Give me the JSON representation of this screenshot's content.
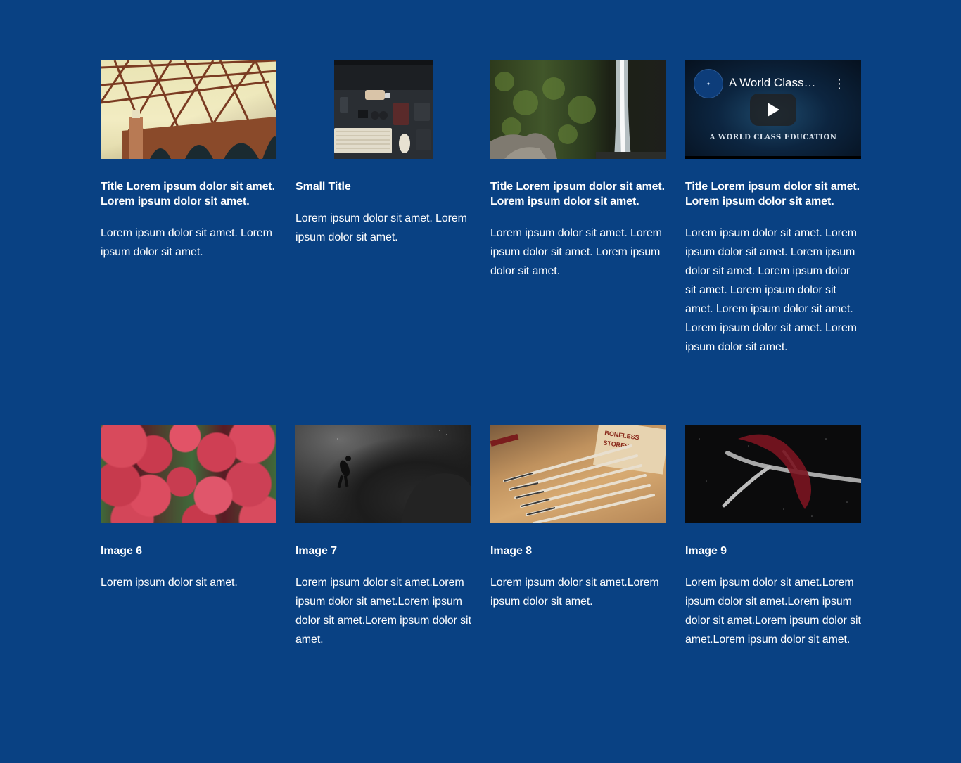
{
  "colors": {
    "background": "#094183",
    "text": "#ffffff"
  },
  "cards": [
    {
      "image_icon": "bridge-photo",
      "title": "Title Lorem ipsum dolor sit amet. Lorem ipsum dolor sit amet.",
      "body": "Lorem ipsum dolor sit amet. Lorem ipsum dolor sit amet."
    },
    {
      "image_icon": "desk-photo",
      "title": "Small Title",
      "body": "Lorem ipsum dolor sit amet. Lorem ipsum dolor sit amet."
    },
    {
      "image_icon": "waterfall-photo",
      "title": "Title Lorem ipsum dolor sit amet. Lorem ipsum dolor sit amet.",
      "body": "Lorem ipsum dolor sit amet. Lorem ipsum dolor sit amet. Lorem ipsum dolor sit amet."
    },
    {
      "video": {
        "title": "A World Class…",
        "caption": "A WORLD CLASS EDUCATION"
      },
      "title": "Title Lorem ipsum dolor sit amet. Lorem ipsum dolor sit amet.",
      "body": "Lorem ipsum dolor sit amet. Lorem ipsum dolor sit amet. Lorem ipsum dolor sit amet. Lorem ipsum dolor sit amet. Lorem ipsum dolor sit amet. Lorem ipsum dolor sit amet. Lorem ipsum dolor sit amet. Lorem ipsum dolor sit amet."
    },
    {
      "image_icon": "strawberries-photo",
      "title": "Image 6",
      "body": "Lorem ipsum dolor sit amet."
    },
    {
      "image_icon": "diver-photo",
      "title": "Image 7",
      "body": "Lorem ipsum dolor sit amet.Lorem ipsum dolor sit amet.Lorem ipsum dolor sit amet.Lorem ipsum dolor sit amet."
    },
    {
      "image_icon": "pencils-photo",
      "title": "Image 8",
      "body": "Lorem ipsum dolor sit amet.Lorem ipsum dolor sit amet."
    },
    {
      "image_icon": "antler-photo",
      "title": "Image 9",
      "body": "Lorem ipsum dolor sit amet.Lorem ipsum dolor sit amet.Lorem ipsum dolor sit amet.Lorem ipsum dolor sit amet.Lorem ipsum dolor sit amet."
    }
  ]
}
